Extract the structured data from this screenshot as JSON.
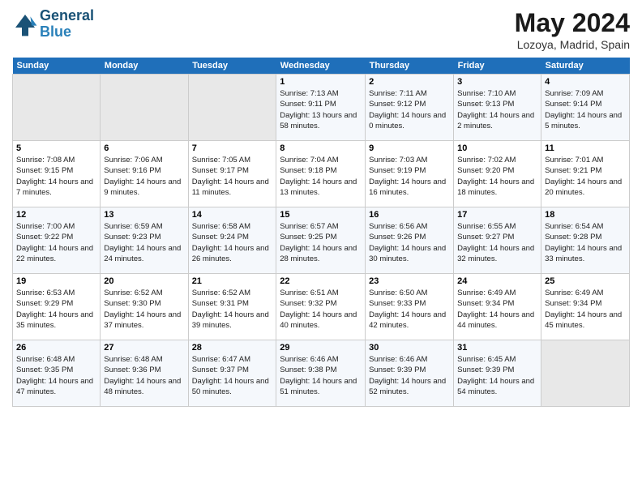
{
  "header": {
    "logo_line1": "General",
    "logo_line2": "Blue",
    "month": "May 2024",
    "location": "Lozoya, Madrid, Spain"
  },
  "days_of_week": [
    "Sunday",
    "Monday",
    "Tuesday",
    "Wednesday",
    "Thursday",
    "Friday",
    "Saturday"
  ],
  "weeks": [
    [
      {
        "day": "",
        "info": ""
      },
      {
        "day": "",
        "info": ""
      },
      {
        "day": "",
        "info": ""
      },
      {
        "day": "1",
        "info": "Sunrise: 7:13 AM\nSunset: 9:11 PM\nDaylight: 13 hours\nand 58 minutes."
      },
      {
        "day": "2",
        "info": "Sunrise: 7:11 AM\nSunset: 9:12 PM\nDaylight: 14 hours\nand 0 minutes."
      },
      {
        "day": "3",
        "info": "Sunrise: 7:10 AM\nSunset: 9:13 PM\nDaylight: 14 hours\nand 2 minutes."
      },
      {
        "day": "4",
        "info": "Sunrise: 7:09 AM\nSunset: 9:14 PM\nDaylight: 14 hours\nand 5 minutes."
      }
    ],
    [
      {
        "day": "5",
        "info": "Sunrise: 7:08 AM\nSunset: 9:15 PM\nDaylight: 14 hours\nand 7 minutes."
      },
      {
        "day": "6",
        "info": "Sunrise: 7:06 AM\nSunset: 9:16 PM\nDaylight: 14 hours\nand 9 minutes."
      },
      {
        "day": "7",
        "info": "Sunrise: 7:05 AM\nSunset: 9:17 PM\nDaylight: 14 hours\nand 11 minutes."
      },
      {
        "day": "8",
        "info": "Sunrise: 7:04 AM\nSunset: 9:18 PM\nDaylight: 14 hours\nand 13 minutes."
      },
      {
        "day": "9",
        "info": "Sunrise: 7:03 AM\nSunset: 9:19 PM\nDaylight: 14 hours\nand 16 minutes."
      },
      {
        "day": "10",
        "info": "Sunrise: 7:02 AM\nSunset: 9:20 PM\nDaylight: 14 hours\nand 18 minutes."
      },
      {
        "day": "11",
        "info": "Sunrise: 7:01 AM\nSunset: 9:21 PM\nDaylight: 14 hours\nand 20 minutes."
      }
    ],
    [
      {
        "day": "12",
        "info": "Sunrise: 7:00 AM\nSunset: 9:22 PM\nDaylight: 14 hours\nand 22 minutes."
      },
      {
        "day": "13",
        "info": "Sunrise: 6:59 AM\nSunset: 9:23 PM\nDaylight: 14 hours\nand 24 minutes."
      },
      {
        "day": "14",
        "info": "Sunrise: 6:58 AM\nSunset: 9:24 PM\nDaylight: 14 hours\nand 26 minutes."
      },
      {
        "day": "15",
        "info": "Sunrise: 6:57 AM\nSunset: 9:25 PM\nDaylight: 14 hours\nand 28 minutes."
      },
      {
        "day": "16",
        "info": "Sunrise: 6:56 AM\nSunset: 9:26 PM\nDaylight: 14 hours\nand 30 minutes."
      },
      {
        "day": "17",
        "info": "Sunrise: 6:55 AM\nSunset: 9:27 PM\nDaylight: 14 hours\nand 32 minutes."
      },
      {
        "day": "18",
        "info": "Sunrise: 6:54 AM\nSunset: 9:28 PM\nDaylight: 14 hours\nand 33 minutes."
      }
    ],
    [
      {
        "day": "19",
        "info": "Sunrise: 6:53 AM\nSunset: 9:29 PM\nDaylight: 14 hours\nand 35 minutes."
      },
      {
        "day": "20",
        "info": "Sunrise: 6:52 AM\nSunset: 9:30 PM\nDaylight: 14 hours\nand 37 minutes."
      },
      {
        "day": "21",
        "info": "Sunrise: 6:52 AM\nSunset: 9:31 PM\nDaylight: 14 hours\nand 39 minutes."
      },
      {
        "day": "22",
        "info": "Sunrise: 6:51 AM\nSunset: 9:32 PM\nDaylight: 14 hours\nand 40 minutes."
      },
      {
        "day": "23",
        "info": "Sunrise: 6:50 AM\nSunset: 9:33 PM\nDaylight: 14 hours\nand 42 minutes."
      },
      {
        "day": "24",
        "info": "Sunrise: 6:49 AM\nSunset: 9:34 PM\nDaylight: 14 hours\nand 44 minutes."
      },
      {
        "day": "25",
        "info": "Sunrise: 6:49 AM\nSunset: 9:34 PM\nDaylight: 14 hours\nand 45 minutes."
      }
    ],
    [
      {
        "day": "26",
        "info": "Sunrise: 6:48 AM\nSunset: 9:35 PM\nDaylight: 14 hours\nand 47 minutes."
      },
      {
        "day": "27",
        "info": "Sunrise: 6:48 AM\nSunset: 9:36 PM\nDaylight: 14 hours\nand 48 minutes."
      },
      {
        "day": "28",
        "info": "Sunrise: 6:47 AM\nSunset: 9:37 PM\nDaylight: 14 hours\nand 50 minutes."
      },
      {
        "day": "29",
        "info": "Sunrise: 6:46 AM\nSunset: 9:38 PM\nDaylight: 14 hours\nand 51 minutes."
      },
      {
        "day": "30",
        "info": "Sunrise: 6:46 AM\nSunset: 9:39 PM\nDaylight: 14 hours\nand 52 minutes."
      },
      {
        "day": "31",
        "info": "Sunrise: 6:45 AM\nSunset: 9:39 PM\nDaylight: 14 hours\nand 54 minutes."
      },
      {
        "day": "",
        "info": ""
      }
    ]
  ]
}
